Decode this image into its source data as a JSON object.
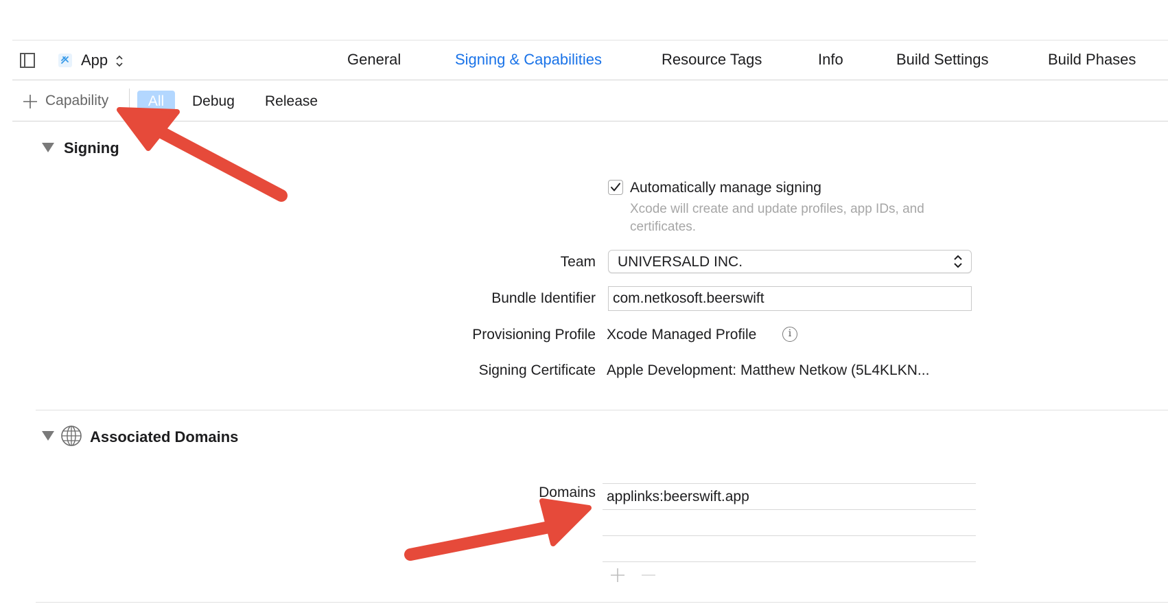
{
  "header": {
    "target_name": "App",
    "tabs": [
      {
        "label": "General"
      },
      {
        "label": "Signing & Capabilities",
        "active": true
      },
      {
        "label": "Resource Tags"
      },
      {
        "label": "Info"
      },
      {
        "label": "Build Settings"
      },
      {
        "label": "Build Phases"
      }
    ]
  },
  "toolbar": {
    "add_capability_label": "Capability",
    "filters": [
      {
        "label": "All",
        "selected": true
      },
      {
        "label": "Debug"
      },
      {
        "label": "Release"
      }
    ]
  },
  "signing": {
    "title": "Signing",
    "auto_manage_label": "Automatically manage signing",
    "auto_manage_checked": true,
    "auto_manage_description": "Xcode will create and update profiles, app IDs, and certificates.",
    "team_label": "Team",
    "team_value": "UNIVERSALD INC.",
    "bundle_id_label": "Bundle Identifier",
    "bundle_id_value": "com.netkosoft.beerswift",
    "provisioning_label": "Provisioning Profile",
    "provisioning_value": "Xcode Managed Profile",
    "certificate_label": "Signing Certificate",
    "certificate_value": "Apple Development: Matthew Netkow (5L4KLKN..."
  },
  "associated_domains": {
    "title": "Associated Domains",
    "domains_label": "Domains",
    "domains": [
      "applinks:beerswift.app",
      "",
      ""
    ]
  },
  "colors": {
    "accent": "#1a73e8",
    "selected_filter_bg": "#b3d7ff",
    "annotation_arrow": "#f05a4a"
  }
}
